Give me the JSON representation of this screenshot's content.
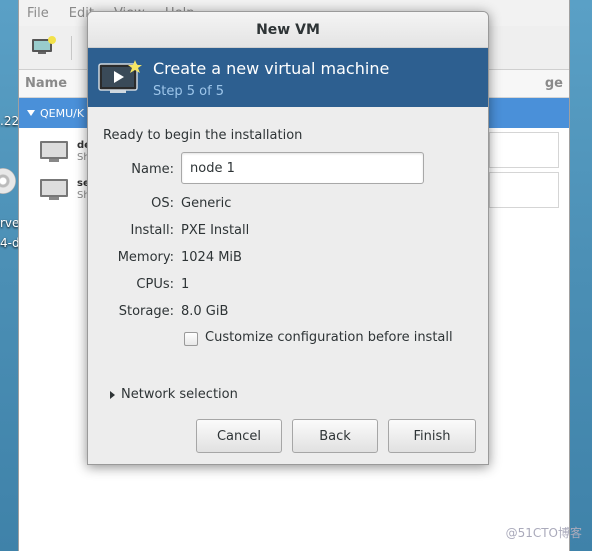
{
  "background_window": {
    "menu": [
      "File",
      "Edit",
      "View",
      "Help"
    ],
    "columns": {
      "name": "Name",
      "right": "ge"
    },
    "connection_group": "QEMU/K",
    "vms": [
      {
        "name": "de",
        "status": "Sh"
      },
      {
        "name": "se",
        "status": "Sh"
      }
    ]
  },
  "desktop": {
    "label_top": ".22",
    "label_bottom_1": "rve",
    "label_bottom_2": "4-d"
  },
  "dialog": {
    "title": "New VM",
    "banner_title": "Create a new virtual machine",
    "banner_step": "Step 5 of 5",
    "ready_text": "Ready to begin the installation",
    "name_label": "Name:",
    "name_value": "node 1",
    "summary": [
      {
        "label": "OS:",
        "value": "Generic"
      },
      {
        "label": "Install:",
        "value": "PXE Install"
      },
      {
        "label": "Memory:",
        "value": "1024 MiB"
      },
      {
        "label": "CPUs:",
        "value": "1"
      },
      {
        "label": "Storage:",
        "value": "8.0 GiB"
      }
    ],
    "customize_label": "Customize configuration before install",
    "customize_checked": false,
    "network_expander": "Network selection",
    "buttons": {
      "cancel": "Cancel",
      "back": "Back",
      "finish": "Finish"
    }
  },
  "watermark": "@51CTO博客",
  "colors": {
    "banner": "#2d5f90",
    "selection": "#4a90d9",
    "desktop": "#4b8fb5"
  }
}
